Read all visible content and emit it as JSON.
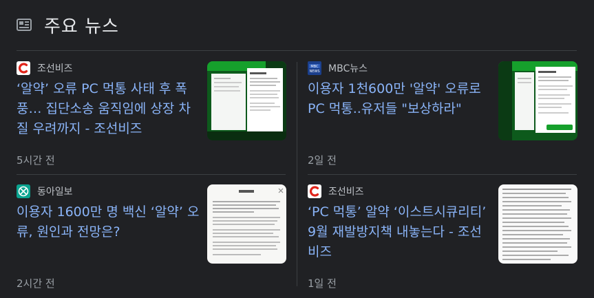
{
  "header": {
    "title": "주요 뉴스",
    "icon": "newspaper-icon"
  },
  "colors": {
    "background": "#202124",
    "link": "#8ab4f8",
    "meta": "#9aa0a6",
    "divider": "#3c4043"
  },
  "articles": [
    {
      "source": "조선비즈",
      "source_icon": "chosunbiz-logo",
      "headline": "‘알약’ 오류 PC 먹통 사태 후 폭풍… 집단소송 움직임에 상장 차질 우려까지 - 조선비즈",
      "time": "5시간 전",
      "thumbnail": "green-dialog-screenshot"
    },
    {
      "source": "MBC뉴스",
      "source_icon": "mbc-news-logo",
      "headline": "이용자 1천600만 '알약' 오류로 PC 먹통..유저들 \"보상하라\"",
      "time": "2일 전",
      "thumbnail": "green-dialog-screenshot"
    },
    {
      "source": "동아일보",
      "source_icon": "donga-logo",
      "headline": "이용자 1600만 명 백신 ‘알약’ 오류, 원인과 전망은?",
      "time": "2시간 전",
      "thumbnail": "notice-document"
    },
    {
      "source": "조선비즈",
      "source_icon": "chosunbiz-logo",
      "headline": "‘PC 먹통’ 알약 ‘이스트시큐리티’ 9월 재발방지책 내놓는다 - 조선비즈",
      "time": "1일 전",
      "thumbnail": "text-document"
    }
  ]
}
